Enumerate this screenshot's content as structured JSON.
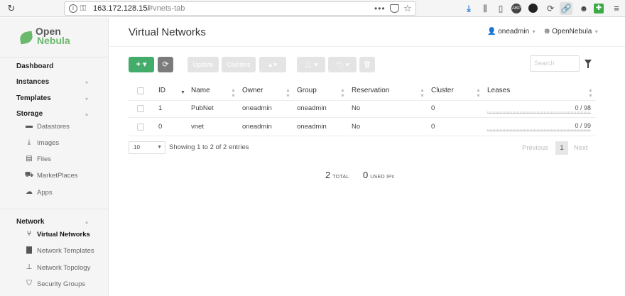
{
  "browser": {
    "url_host": "163.172.128.15/",
    "url_path": "#vnets-tab",
    "dots": "•••",
    "abp_label": "ABP"
  },
  "logo": {
    "line1": "Open",
    "line2": "Nebula"
  },
  "sidebar": {
    "heads": [
      {
        "label": "Dashboard"
      },
      {
        "label": "Instances"
      },
      {
        "label": "Templates"
      },
      {
        "label": "Storage"
      }
    ],
    "storage_items": [
      {
        "label": "Datastores",
        "icon": "folder-icon"
      },
      {
        "label": "Images",
        "icon": "download-icon"
      },
      {
        "label": "Files",
        "icon": "files-icon"
      },
      {
        "label": "MarketPlaces",
        "icon": "cart-icon"
      },
      {
        "label": "Apps",
        "icon": "cloud-icon"
      }
    ],
    "network_head": "Network",
    "network_items": [
      {
        "label": "Virtual Networks",
        "icon": "network-icon",
        "active": true
      },
      {
        "label": "Network Templates",
        "icon": "template-icon"
      },
      {
        "label": "Network Topology",
        "icon": "sitemap-icon"
      },
      {
        "label": "Security Groups",
        "icon": "shield-icon"
      }
    ]
  },
  "header": {
    "title": "Virtual Networks",
    "user": "oneadmin",
    "zone": "OpenNebula"
  },
  "toolbar": {
    "add_label": "+ ▾",
    "update_label": "Update",
    "clusters_label": "Clusters",
    "search_placeholder": "Search"
  },
  "table": {
    "columns": [
      "ID",
      "Name",
      "Owner",
      "Group",
      "Reservation",
      "Cluster",
      "Leases"
    ],
    "rows": [
      {
        "id": "1",
        "name": "PubNet",
        "owner": "oneadmin",
        "group": "oneadmin",
        "reservation": "No",
        "cluster": "0",
        "leases": "0 / 98"
      },
      {
        "id": "0",
        "name": "vnet",
        "owner": "oneadmin",
        "group": "oneadmin",
        "reservation": "No",
        "cluster": "0",
        "leases": "0 / 99"
      }
    ]
  },
  "footer": {
    "page_size": "10",
    "entries_info": "Showing 1 to 2 of 2 entries",
    "prev": "Previous",
    "page": "1",
    "next": "Next"
  },
  "summary": {
    "total_value": "2",
    "total_label": "TOTAL",
    "used_value": "0",
    "used_label": "USED IPs"
  },
  "colors": {
    "accent_green": "#43ac6a",
    "refresh_gray": "#7b7b7b",
    "logo_green": "#6ab96c"
  }
}
